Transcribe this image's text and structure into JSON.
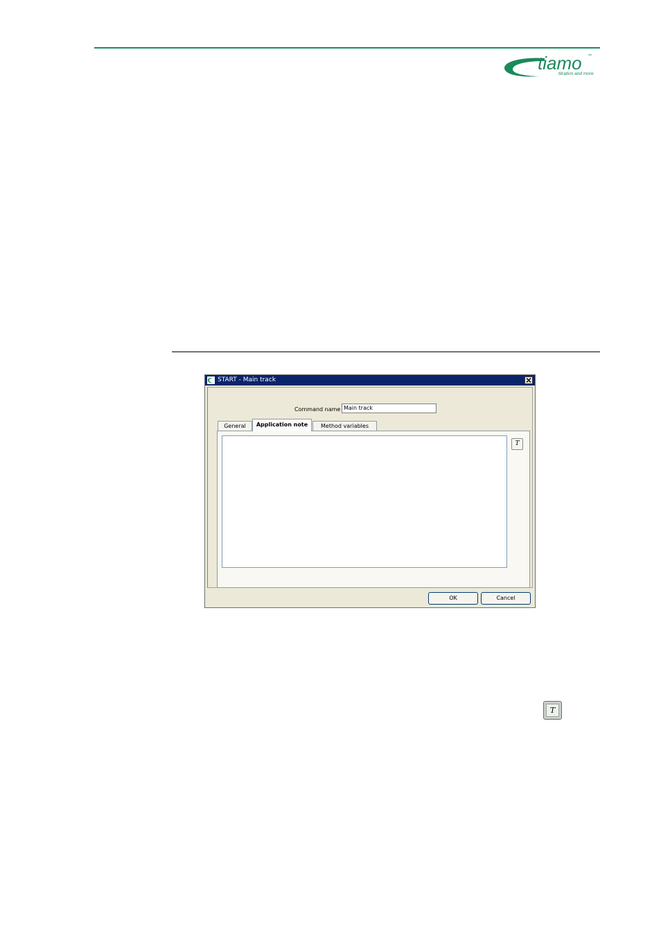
{
  "logo": {
    "brand": "tiamo",
    "trademark": "™",
    "tagline": "titration and more"
  },
  "dialog": {
    "title": "START - Main track",
    "command_name_label": "Command name",
    "command_name_value": "Main track",
    "tabs": [
      {
        "label": "General",
        "selected": false
      },
      {
        "label": "Application note",
        "selected": true
      },
      {
        "label": "Method variables",
        "selected": false
      }
    ],
    "application_note_text": "",
    "text_button_label": "T",
    "ok_label": "OK",
    "cancel_label": "Cancel"
  },
  "standalone_text_button_label": "T",
  "colors": {
    "brand_green": "#1a8a5c",
    "title_bar": "#0a246a"
  }
}
